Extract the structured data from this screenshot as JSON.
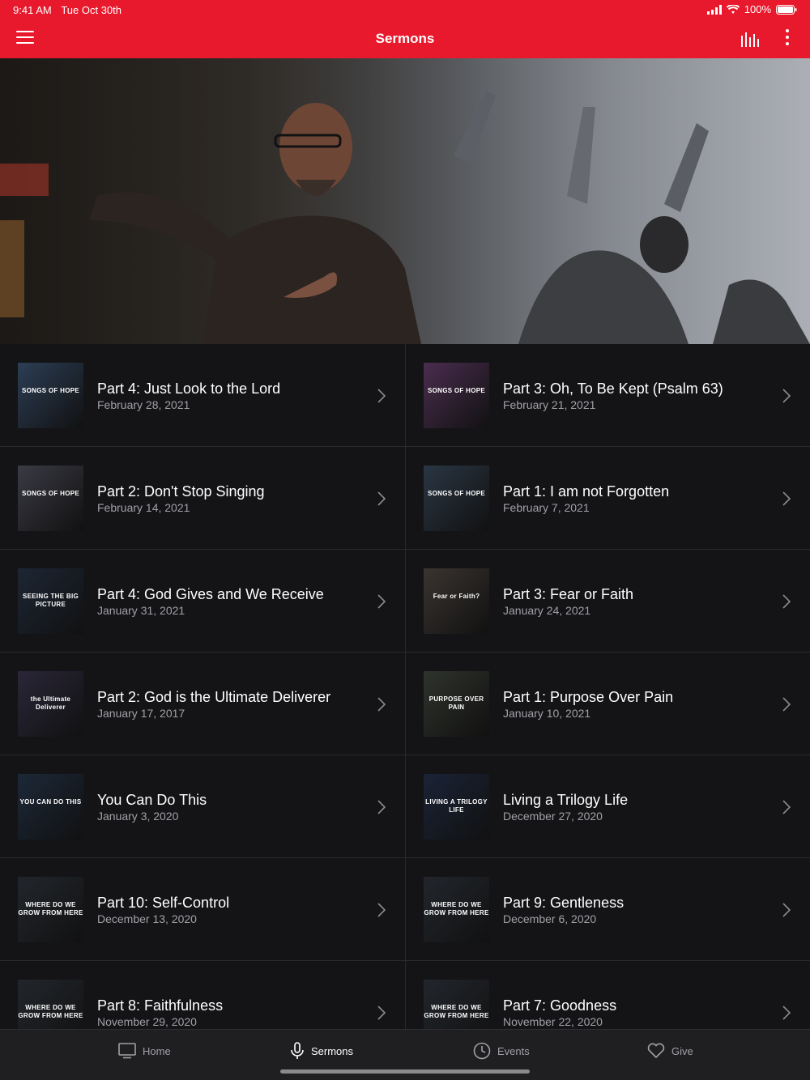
{
  "status": {
    "time": "9:41 AM",
    "date": "Tue Oct 30th",
    "battery": "100%"
  },
  "nav": {
    "title": "Sermons"
  },
  "hero": {},
  "sermons": [
    {
      "title": "Part 4:  Just Look to the Lord",
      "date": "February 28, 2021",
      "thumb": "SONGS OF HOPE",
      "color": "#2c3e55"
    },
    {
      "title": "Part 3: Oh, To Be Kept (Psalm 63)",
      "date": "February 21, 2021",
      "thumb": "SONGS OF HOPE",
      "color": "#4a2d4f"
    },
    {
      "title": "Part 2: Don't Stop Singing",
      "date": "February 14, 2021",
      "thumb": "SONGS OF HOPE",
      "color": "#3a3a44"
    },
    {
      "title": "Part 1:  I am not Forgotten",
      "date": "February 7, 2021",
      "thumb": "SONGS OF HOPE",
      "color": "#2a3644"
    },
    {
      "title": "Part 4:  God Gives and We Receive",
      "date": "January 31, 2021",
      "thumb": "SEEING THE BIG PICTURE",
      "color": "#1d2634"
    },
    {
      "title": "Part 3:  Fear or Faith",
      "date": "January 24, 2021",
      "thumb": "Fear or Faith?",
      "color": "#3a3430"
    },
    {
      "title": "Part 2:  God is the Ultimate Deliverer",
      "date": "January 17, 2017",
      "thumb": "the Ultimate Deliverer",
      "color": "#2a2638"
    },
    {
      "title": "Part 1:  Purpose Over Pain",
      "date": "January 10, 2021",
      "thumb": "PURPOSE OVER PAIN",
      "color": "#2f332c"
    },
    {
      "title": "You Can Do This",
      "date": "January 3, 2020",
      "thumb": "YOU CAN DO THIS",
      "color": "#1c2838"
    },
    {
      "title": "Living a Trilogy Life",
      "date": "December 27, 2020",
      "thumb": "LIVING A TRILOGY LIFE",
      "color": "#1a2336"
    },
    {
      "title": "Part 10: Self-Control",
      "date": "December 13, 2020",
      "thumb": "WHERE DO WE GROW FROM HERE",
      "color": "#22262c"
    },
    {
      "title": "Part 9: Gentleness",
      "date": "December 6, 2020",
      "thumb": "WHERE DO WE GROW FROM HERE",
      "color": "#22262c"
    },
    {
      "title": "Part 8: Faithfulness",
      "date": "November 29, 2020",
      "thumb": "WHERE DO WE GROW FROM HERE",
      "color": "#22262c"
    },
    {
      "title": "Part 7: Goodness",
      "date": "November 22, 2020",
      "thumb": "WHERE DO WE GROW FROM HERE",
      "color": "#22262c"
    }
  ],
  "tabs": [
    {
      "label": "Home",
      "icon": "tv-icon"
    },
    {
      "label": "Sermons",
      "icon": "microphone-icon"
    },
    {
      "label": "Events",
      "icon": "clock-icon"
    },
    {
      "label": "Give",
      "icon": "heart-icon"
    }
  ],
  "colors": {
    "brand": "#e8192c",
    "background": "#141417",
    "tabbar": "#1f1f22"
  }
}
